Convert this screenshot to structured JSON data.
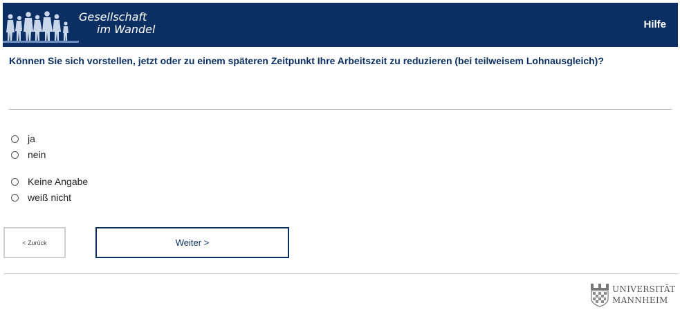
{
  "header": {
    "logo": {
      "line1": "Gesellschaft",
      "line2": "im Wandel",
      "icon": "people-silhouettes-icon"
    },
    "help_label": "Hilfe"
  },
  "question": {
    "text": "Können Sie sich vorstellen, jetzt oder zu einem späteren Zeitpunkt Ihre Arbeitszeit zu reduzieren (bei teilweisem Lohnausgleich)?"
  },
  "options": [
    {
      "label": "ja",
      "selected": false
    },
    {
      "label": "nein",
      "selected": false
    },
    {
      "label": "Keine Angabe",
      "selected": false
    },
    {
      "label": "weiß nicht",
      "selected": false
    }
  ],
  "nav": {
    "back_label": "< Zurück",
    "next_label": "Weiter >"
  },
  "footer": {
    "university_line1": "UNIVERSITÄT",
    "university_line2": "MANNHEIM",
    "crest_icon": "university-crest-icon"
  },
  "colors": {
    "brand": "#0b2f63",
    "divider": "#b8b8b8"
  }
}
